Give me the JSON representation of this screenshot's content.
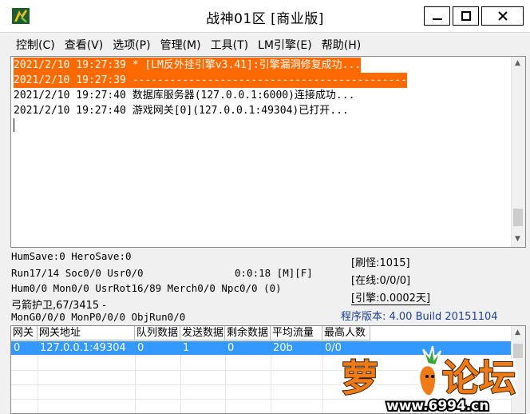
{
  "window": {
    "title": "战神01区 [商业版]",
    "minimize_icon": "minimize-icon",
    "maximize_icon": "maximize-icon",
    "close_icon": "close-icon"
  },
  "menu": [
    "控制(C)",
    "查看(V)",
    "选项(P)",
    "管理(M)",
    "工具(T)",
    "LM引擎(E)",
    "帮助(H)"
  ],
  "log": [
    {
      "text": "2021/2/10 19:27:39 * [LM反外挂引擎v3.41]:引擎漏洞修复成功...",
      "highlight": true
    },
    {
      "text": "2021/2/10 19:27:39 --------------------------------------------",
      "highlight": true
    },
    {
      "text": "2021/2/10 19:27:40 数据库服务器(127.0.0.1:6000)连接成功...",
      "highlight": false
    },
    {
      "text": "2021/2/10 19:27:40 游戏网关[0](127.0.0.1:49304)已打开...",
      "highlight": false
    }
  ],
  "status": {
    "line1": "HumSave:0 HeroSave:0",
    "line2a": "Run17/14 Soc0/0 Usr0/0",
    "line2b": "0:0:18 [M][F]",
    "line3": "Hum0/0 Mon0/0 UsrRot16/89 Merch0/0 Npc0/0 (0)",
    "line4": "弓箭护卫,67/3415 -",
    "line5": "MonG0/0/0 MonP0/0/0 ObjRun0/0",
    "refresh": "[刷怪:1015]",
    "online": "[在线:0/0/0]",
    "engine": "[引擎:0.0002天]",
    "version": "程序版本: 4.00 Build 20151104"
  },
  "table": {
    "headers": [
      "网关",
      "网关地址",
      "队列数据",
      "发送数据",
      "剩余数据",
      "平均流量",
      "最高人数"
    ],
    "rows": [
      [
        "0",
        "127.0.0.1:49304",
        "0",
        "1",
        "0",
        "20b",
        "0/0"
      ]
    ]
  },
  "watermark": {
    "brand": "萝卜论坛",
    "url": "www.6994.cn"
  },
  "colors": {
    "log_highlight": "#ff6a00",
    "row_selected": "#3399ff",
    "version_text": "#1a3fa0"
  }
}
